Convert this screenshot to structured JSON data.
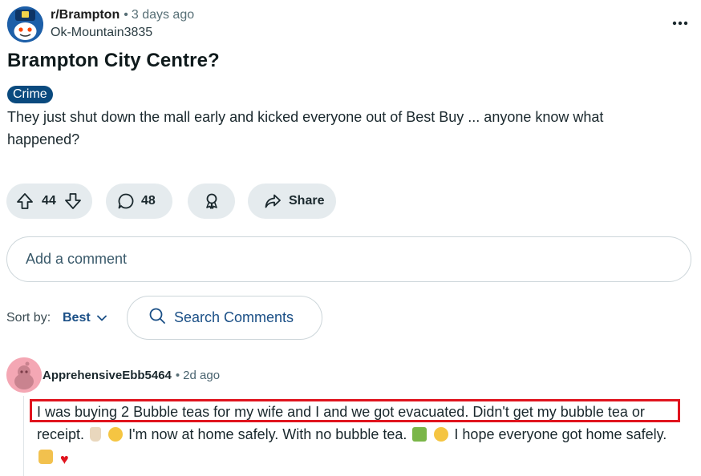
{
  "post": {
    "subreddit": "r/Brampton",
    "separator": "•",
    "time": "3 days ago",
    "author": "Ok-Mountain3835",
    "title": "Brampton City Centre?",
    "flair": "Crime",
    "body": "They just shut down the mall early and kicked everyone out of Best Buy ... anyone know what happened?",
    "more_icon": "ellipsis-icon"
  },
  "actions": {
    "upvotes": "44",
    "comments": "48",
    "share_label": "Share",
    "icons": [
      "upvote-icon",
      "downvote-icon",
      "comment-icon",
      "award-icon",
      "share-icon"
    ]
  },
  "add_comment": {
    "placeholder": "Add a comment"
  },
  "sort": {
    "label": "Sort by:",
    "value": "Best",
    "search_label": "Search Comments"
  },
  "comment": {
    "author": "ApprehensiveEbb5464",
    "separator": "•",
    "time": "2d ago",
    "text_part1": "I was buying 2 Bubble teas for my wife and I and we got evacuated. Didn't get my bubble tea or receipt.",
    "text_part2": "I'm now at home safely. With no bubble tea.",
    "text_part3": "I hope everyone got home safely.",
    "emojis": [
      "bubble-tea-emoji",
      "pensive-face-emoji",
      "house-emoji",
      "flushed-face-emoji",
      "folded-hands-emoji",
      "heart-emoji"
    ],
    "highlight_color": "#e0141e"
  },
  "colors": {
    "pill_bg": "#e5ebee",
    "flair_bg": "#0a4a7e",
    "link_blue": "#1a4f86"
  }
}
